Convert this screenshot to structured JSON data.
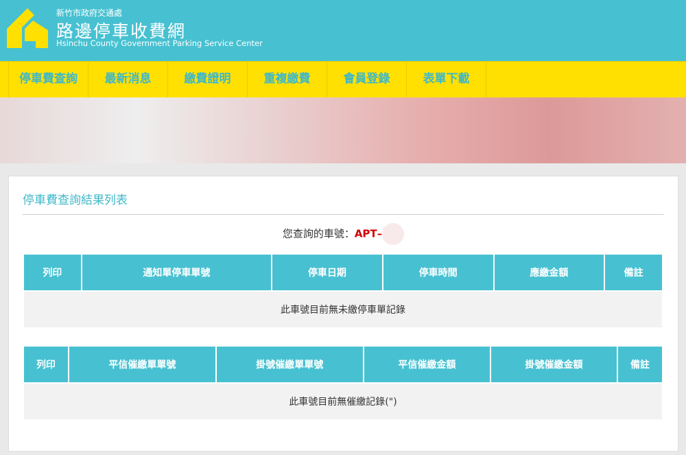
{
  "header": {
    "agency": "新竹市政府交通處",
    "title": "路邊停車收費網",
    "subtitle_en": "Hsinchu County Government Parking Service Center"
  },
  "nav": [
    "停車費查詢",
    "最新消息",
    "繳費證明",
    "重複繳費",
    "會員登錄",
    "表單下載"
  ],
  "panel": {
    "title": "停車費查詢結果列表",
    "query_label": "您查詢的車號：",
    "plate": "APT–"
  },
  "table1": {
    "headers": [
      "列印",
      "通知單停車單號",
      "停車日期",
      "停車時間",
      "應繳金額",
      "備註"
    ],
    "empty": "此車號目前無未繳停車單記錄"
  },
  "table2": {
    "headers": [
      "列印",
      "平信催繳單單號",
      "掛號催繳單單號",
      "平信催繳金額",
      "掛號催繳金額",
      "備註"
    ],
    "empty": "此車號目前無催繳記錄(\")"
  }
}
